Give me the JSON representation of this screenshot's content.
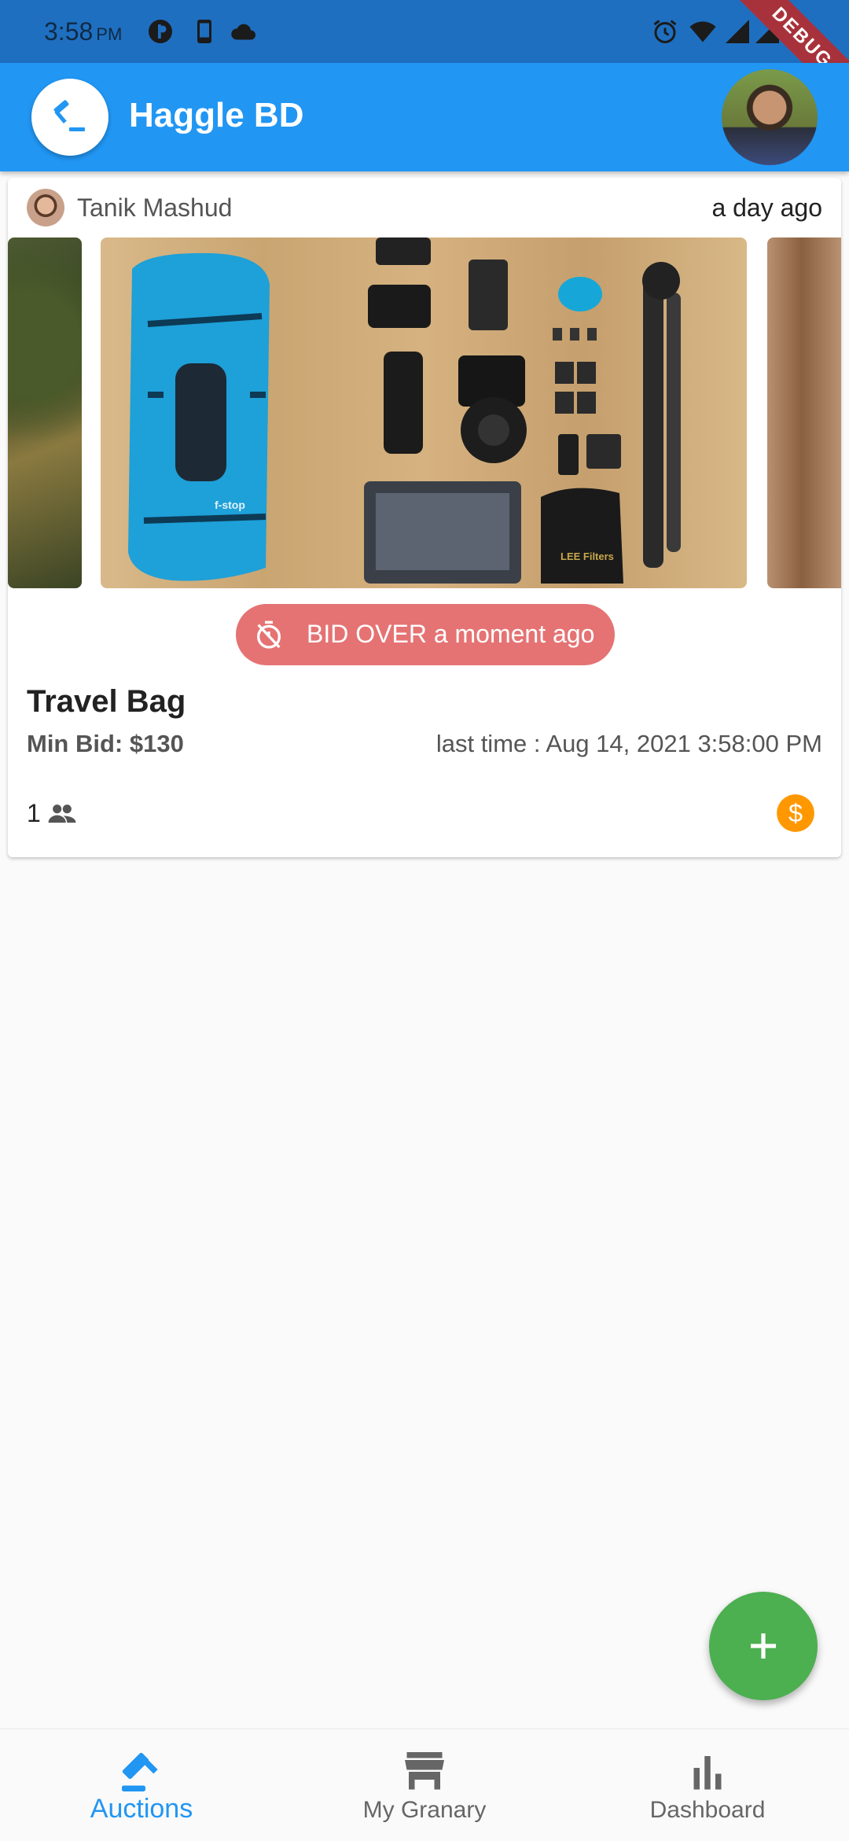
{
  "status_bar": {
    "time": "3:58",
    "ampm": "PM",
    "debug_label": "DEBUG"
  },
  "app_bar": {
    "title": "Haggle BD"
  },
  "auction_card": {
    "seller_name": "Tanik Mashud",
    "posted": "a day ago",
    "bid_status": "BID OVER a moment ago",
    "item_title": "Travel Bag",
    "min_bid": "Min Bid: $130",
    "last_time": "last time : Aug 14, 2021 3:58:00 PM",
    "bidder_count": "1"
  },
  "bottom_nav": {
    "items": [
      {
        "label": "Auctions",
        "icon": "gavel-icon",
        "active": true
      },
      {
        "label": "My Granary",
        "icon": "store-icon",
        "active": false
      },
      {
        "label": "Dashboard",
        "icon": "bar-chart-icon",
        "active": false
      }
    ]
  },
  "colors": {
    "primary": "#2196f3",
    "status_bar": "#1f6fc0",
    "bid_over": "#e57373",
    "fab": "#4caf50",
    "coin": "#ff9800"
  }
}
